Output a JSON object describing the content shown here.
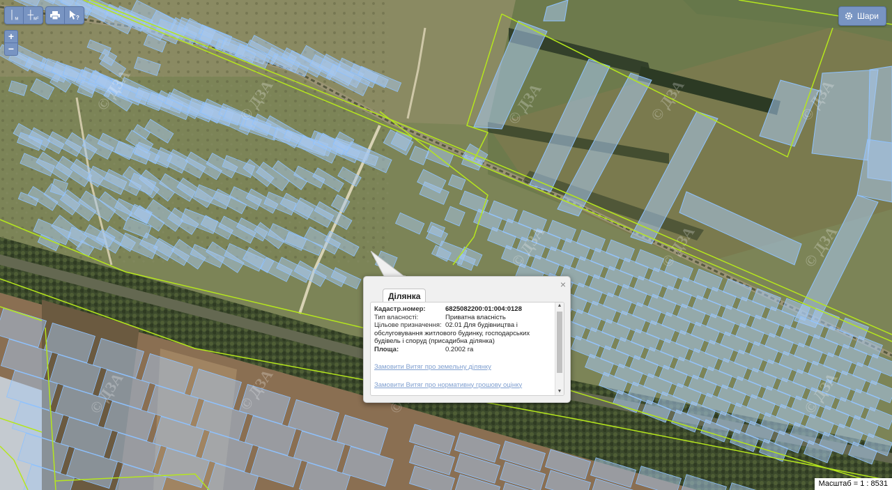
{
  "toolbar": {
    "ruler_label": "м",
    "area_label": "м²"
  },
  "zoom": {
    "in": "+",
    "out": "−"
  },
  "layers_button": {
    "label": "Шари"
  },
  "watermark": "© ДЗА",
  "popup": {
    "tab": "Ділянка",
    "close": "×",
    "fields": [
      {
        "label": "Кадастр.номер:",
        "value": "6825082200:01:004:0128"
      },
      {
        "label": "Тип власності:",
        "value": "Приватна власність"
      },
      {
        "label": "Цільове призначення:",
        "value": "02.01 Для будівництва і"
      }
    ],
    "purpose_continuation": "обслуговування житлового будинку, господарських будівель і споруд (присадибна ділянка)",
    "area_label": "Площа:",
    "area_value": "0.2002 га",
    "link1": "Замовити Витяг про земельну ділянку",
    "link2": "Замовити Витяг про нормативну грошову оцінку"
  },
  "scale": "Масштаб = 1 : 8531",
  "colors": {
    "parcel_fill": "#a8c8ee",
    "parcel_stroke": "#8ec2ff",
    "boundary": "#b5e61d",
    "ui_button": "#7894c2"
  }
}
